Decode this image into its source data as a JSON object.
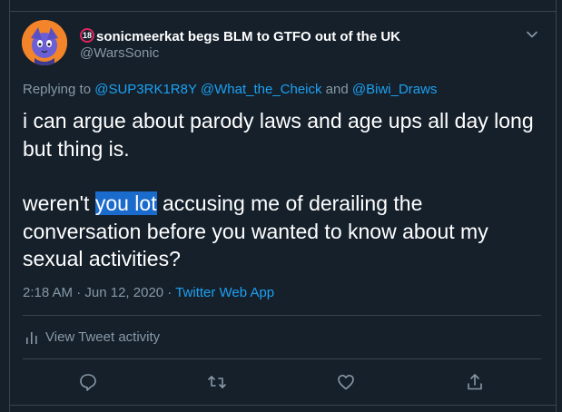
{
  "tweet": {
    "author": {
      "age_badge": "18",
      "display_name": "sonicmeerkat begs BLM to GTFO out of the UK",
      "handle": "@WarsSonic"
    },
    "replying_to": {
      "prefix": "Replying to ",
      "mention_1": "@SUP3RK1R8Y",
      "mention_2": "@What_the_Cheick",
      "conjunction": " and ",
      "mention_3": "@Biwi_Draws"
    },
    "text": {
      "paragraph_1": "i can argue about parody laws and age ups all day long but thing is.",
      "paragraph_2_before": "weren't ",
      "paragraph_2_highlight": "you lot",
      "paragraph_2_after": " accusing me of derailing the conversation before you wanted to know about my sexual activities?"
    },
    "meta": {
      "time": "2:18 AM",
      "separator_1": " · ",
      "date": "Jun 12, 2020",
      "separator_2": " · ",
      "source": "Twitter Web App"
    },
    "activity_label": "View Tweet activity"
  },
  "icons": {
    "reply": "reply-icon",
    "retweet": "retweet-icon",
    "like": "like-icon",
    "share": "share-icon",
    "chevron": "chevron-down-icon",
    "activity": "activity-bars-icon"
  },
  "colors": {
    "background": "#15202b",
    "text_primary": "#ffffff",
    "text_secondary": "#8899a6",
    "link": "#1da1f2",
    "border": "#38444d",
    "selection": "#1a6bcc",
    "age_badge": "#e0245e"
  }
}
